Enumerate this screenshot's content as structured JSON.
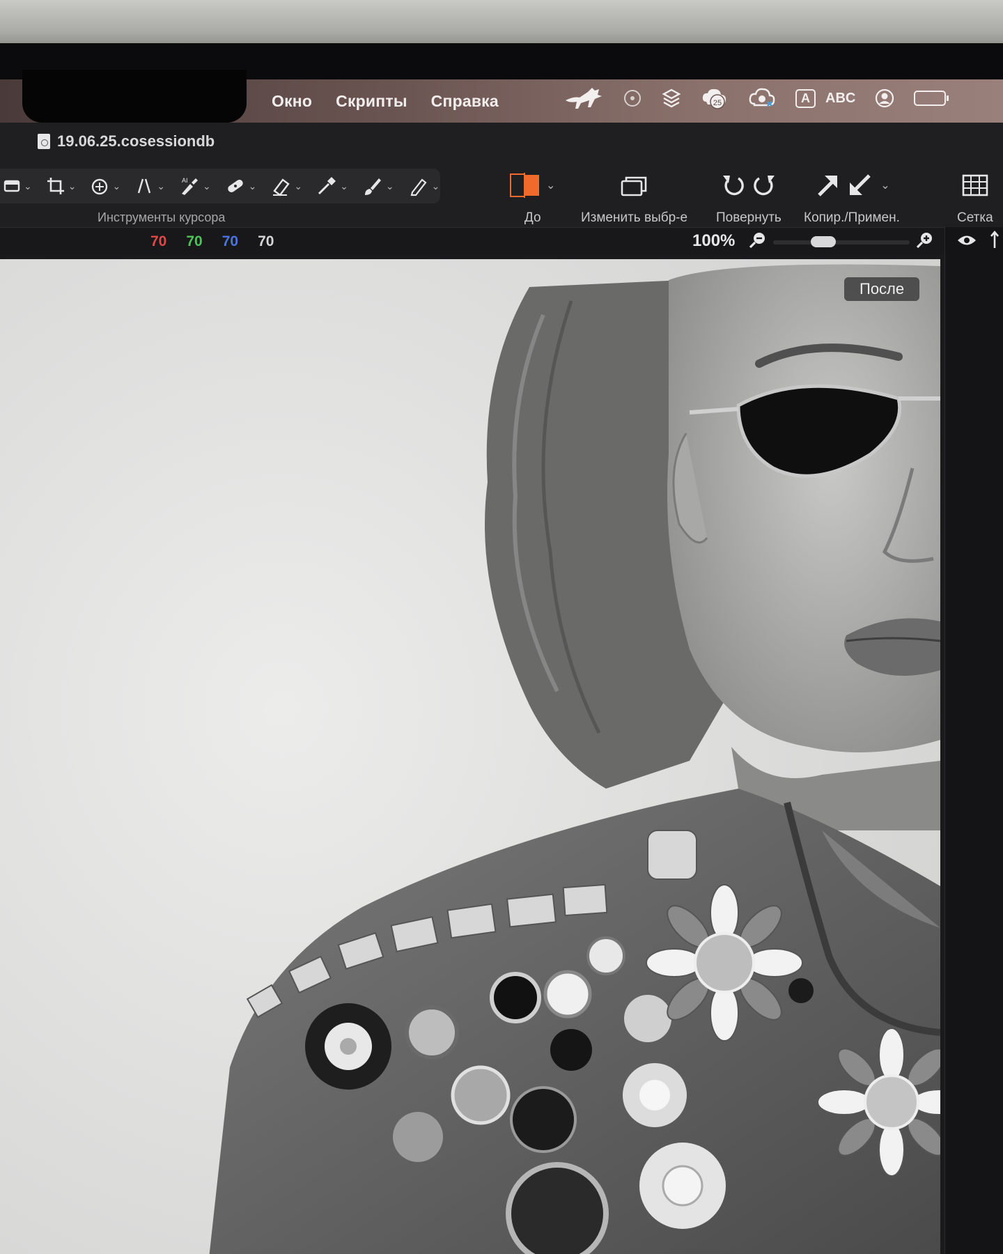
{
  "menubar": {
    "items": [
      "Окно",
      "Скрипты",
      "Справка"
    ],
    "status": {
      "notification_badge": "25",
      "input_source_box": "A",
      "input_source_label": "ABC"
    }
  },
  "document": {
    "title": "19.06.25.cosessiondb"
  },
  "toolbar": {
    "cursor_tools_label": "Инструменты курсора",
    "before_after_label": "До",
    "change_selection_label": "Изменить выбр-е",
    "rotate_label": "Повернуть",
    "copy_apply_label": "Копир./Примен.",
    "grid_label": "Сетка"
  },
  "infobar": {
    "r_value": "70",
    "g_value": "70",
    "b_value": "70",
    "l_value": "70",
    "zoom": "100%"
  },
  "viewer": {
    "after_label": "После"
  },
  "colors": {
    "accent_orange": "#f06a2c",
    "red_channel": "#e0484a",
    "green_channel": "#4fc25a",
    "blue_channel": "#4a74e0",
    "luma_channel": "#d6d6d8"
  }
}
